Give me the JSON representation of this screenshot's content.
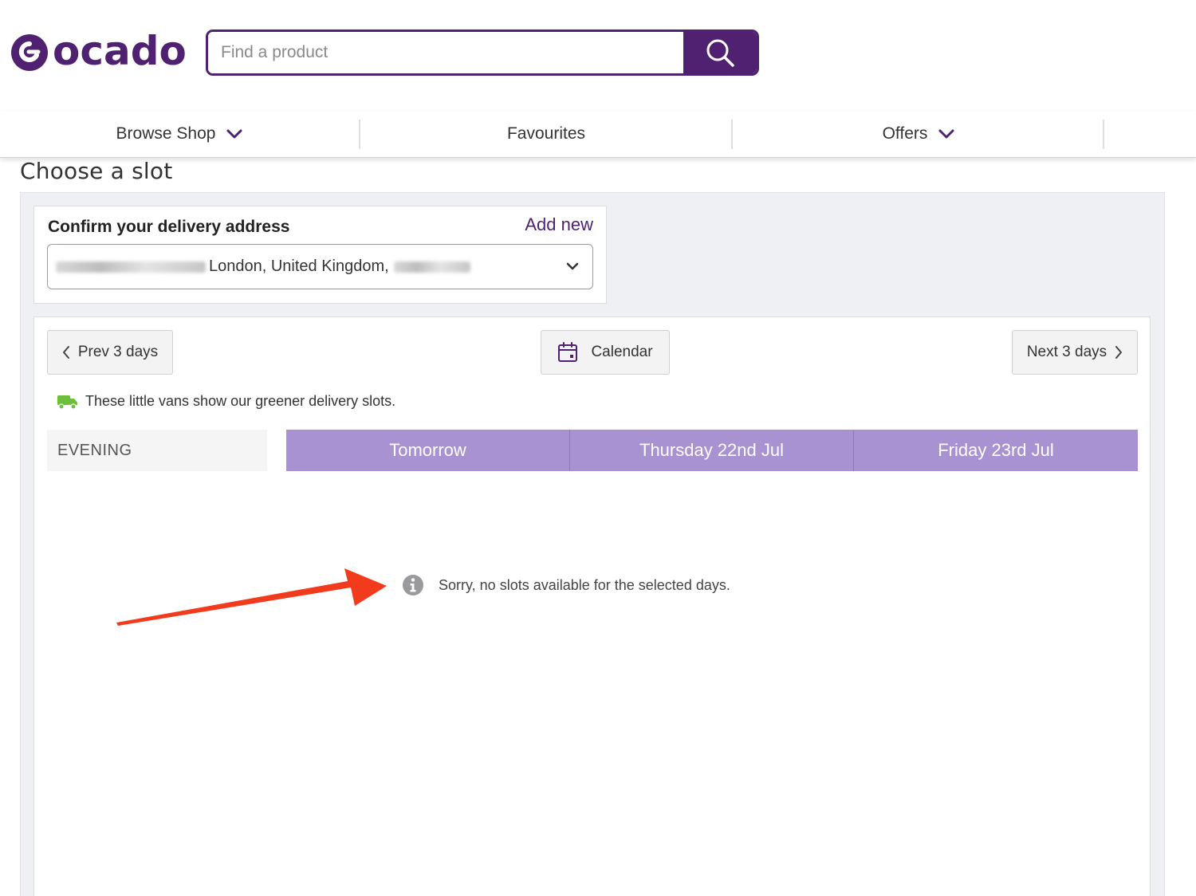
{
  "brand": {
    "name": "ocado",
    "color": "#4f2170"
  },
  "search": {
    "placeholder": "Find a product",
    "icon": "search-icon"
  },
  "nav": {
    "items": [
      {
        "label": "Browse Shop",
        "has_dropdown": true
      },
      {
        "label": "Favourites",
        "has_dropdown": false
      },
      {
        "label": "Offers",
        "has_dropdown": true
      }
    ]
  },
  "page": {
    "title": "Choose a slot"
  },
  "address": {
    "title": "Confirm your delivery address",
    "add_new": "Add new",
    "selected_visible": "London, United Kingdom,"
  },
  "slots": {
    "prev_label": "Prev 3 days",
    "calendar_label": "Calendar",
    "next_label": "Next 3 days",
    "green_note": "These little vans show our greener delivery slots.",
    "period_label": "EVENING",
    "days": [
      "Tomorrow",
      "Thursday 22nd Jul",
      "Friday 23rd Jul"
    ],
    "empty_message": "Sorry, no slots available for the selected days.",
    "header_color": "#a892d2",
    "green_color": "#6bbf3b"
  },
  "annotation": {
    "arrow_color": "#f23a1d"
  }
}
